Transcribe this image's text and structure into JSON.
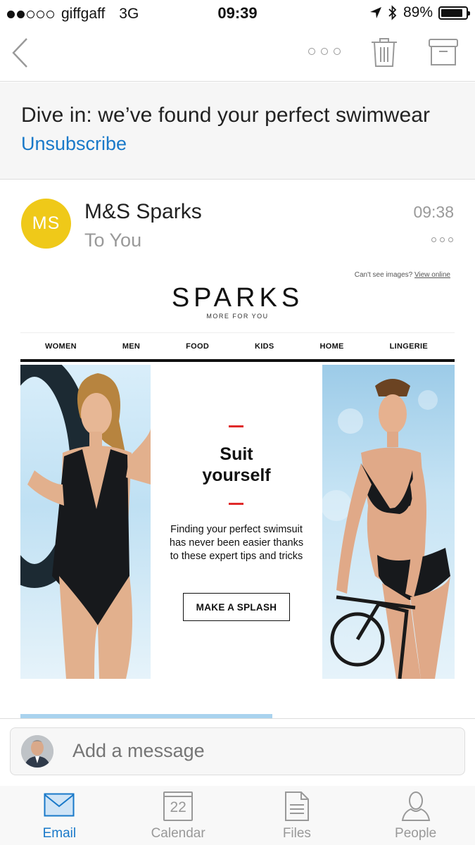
{
  "status": {
    "carrier": "giffgaff",
    "network": "3G",
    "time": "09:39",
    "battery": "89%",
    "battery_level": 0.89
  },
  "toolbar": {
    "back_icon": "chevron-left-icon",
    "more_icon": "more-icon",
    "trash_icon": "trash-icon",
    "archive_icon": "archive-icon"
  },
  "message": {
    "subject": "Dive in: we’ve found your perfect swimwear",
    "unsubscribe": "Unsubscribe",
    "sender_initials": "MS",
    "sender_name": "M&S Sparks",
    "recipient": "To You",
    "time": "09:38",
    "avatar_color": "#efc919"
  },
  "email": {
    "cant_see": "Can't see images?",
    "view_online": "View online",
    "brand": "SPARKS",
    "brand_sub": "MORE FOR YOU",
    "nav": [
      "WOMEN",
      "MEN",
      "FOOD",
      "KIDS",
      "HOME",
      "LINGERIE"
    ],
    "hero_title_1": "Suit",
    "hero_title_2": "yourself",
    "hero_text": "Finding your perfect swimsuit has never been easier thanks to these expert tips and tricks",
    "cta": "MAKE A SPLASH",
    "accent": "#e02a2a"
  },
  "compose": {
    "placeholder": "Add a message"
  },
  "tabs": {
    "email": "Email",
    "calendar": "Calendar",
    "calendar_day": "22",
    "files": "Files",
    "people": "People",
    "active_color": "#1979c9"
  }
}
